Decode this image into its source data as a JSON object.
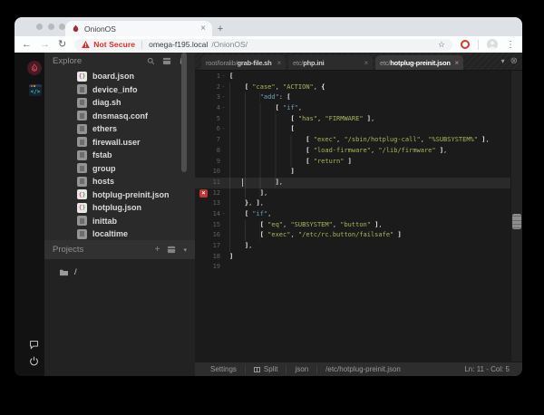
{
  "browser": {
    "tab_title": "OnionOS",
    "tab_close": "×",
    "new_tab": "+",
    "back": "←",
    "forward": "→",
    "reload": "↻",
    "security_text": "Not Secure",
    "url_host": "omega-f195.local",
    "url_path": "/OnionOS/",
    "bookmark_star": "☆",
    "menu_dots": "⋮"
  },
  "sidebar": {
    "explore_title": "Explore",
    "files": [
      {
        "name": "board.json",
        "type": "json"
      },
      {
        "name": "device_info",
        "type": "plain"
      },
      {
        "name": "diag.sh",
        "type": "plain"
      },
      {
        "name": "dnsmasq.conf",
        "type": "plain"
      },
      {
        "name": "ethers",
        "type": "plain"
      },
      {
        "name": "firewall.user",
        "type": "plain"
      },
      {
        "name": "fstab",
        "type": "plain"
      },
      {
        "name": "group",
        "type": "plain"
      },
      {
        "name": "hosts",
        "type": "plain"
      },
      {
        "name": "hotplug-preinit.json",
        "type": "json"
      },
      {
        "name": "hotplug.json",
        "type": "json"
      },
      {
        "name": "inittab",
        "type": "plain"
      },
      {
        "name": "localtime",
        "type": "plain"
      }
    ],
    "projects_title": "Projects",
    "project_items": [
      "/"
    ]
  },
  "editor": {
    "tabs": [
      {
        "path": "root/loralib/",
        "name": "grab-file.sh",
        "active": false
      },
      {
        "path": "etc/",
        "name": "php.ini",
        "active": false
      },
      {
        "path": "etc/",
        "name": "hotplug-preinit.json",
        "active": true
      }
    ],
    "tabbar_chevron": "▾",
    "tabbar_close_all": "⊗",
    "current_line": 11,
    "error_line": 12,
    "cursor_col": 5,
    "fold_lines": [
      1,
      2,
      3,
      4,
      6,
      14
    ],
    "lines": [
      [
        [
          "b",
          "["
        ]
      ],
      [
        [
          "p",
          "    "
        ],
        [
          "b",
          "["
        ],
        [
          "p",
          " "
        ],
        [
          "s",
          "\"case\""
        ],
        [
          "u",
          ","
        ],
        [
          "p",
          " "
        ],
        [
          "s",
          "\"ACTION\""
        ],
        [
          "u",
          ","
        ],
        [
          "p",
          " "
        ],
        [
          "b",
          "{"
        ]
      ],
      [
        [
          "p",
          "        "
        ],
        [
          "k",
          "\"add\""
        ],
        [
          "u",
          ":"
        ],
        [
          "p",
          " "
        ],
        [
          "b",
          "["
        ]
      ],
      [
        [
          "p",
          "            "
        ],
        [
          "b",
          "["
        ],
        [
          "p",
          " "
        ],
        [
          "k",
          "\"if\""
        ],
        [
          "u",
          ","
        ]
      ],
      [
        [
          "p",
          "                "
        ],
        [
          "b",
          "["
        ],
        [
          "p",
          " "
        ],
        [
          "s",
          "\"has\""
        ],
        [
          "u",
          ","
        ],
        [
          "p",
          " "
        ],
        [
          "s",
          "\"FIRMWARE\""
        ],
        [
          "p",
          " "
        ],
        [
          "b",
          "]"
        ],
        [
          "u",
          ","
        ]
      ],
      [
        [
          "p",
          "                "
        ],
        [
          "b",
          "["
        ]
      ],
      [
        [
          "p",
          "                    "
        ],
        [
          "b",
          "["
        ],
        [
          "p",
          " "
        ],
        [
          "s",
          "\"exec\""
        ],
        [
          "u",
          ","
        ],
        [
          "p",
          " "
        ],
        [
          "s",
          "\"/sbin/hotplug-call\""
        ],
        [
          "u",
          ","
        ],
        [
          "p",
          " "
        ],
        [
          "s",
          "\"%SUBSYSTEM%\""
        ],
        [
          "p",
          " "
        ],
        [
          "b",
          "]"
        ],
        [
          "u",
          ","
        ]
      ],
      [
        [
          "p",
          "                    "
        ],
        [
          "b",
          "["
        ],
        [
          "p",
          " "
        ],
        [
          "s",
          "\"load-firmware\""
        ],
        [
          "u",
          ","
        ],
        [
          "p",
          " "
        ],
        [
          "s",
          "\"/lib/firmware\""
        ],
        [
          "p",
          " "
        ],
        [
          "b",
          "]"
        ],
        [
          "u",
          ","
        ]
      ],
      [
        [
          "p",
          "                    "
        ],
        [
          "b",
          "["
        ],
        [
          "p",
          " "
        ],
        [
          "s",
          "\"return\""
        ],
        [
          "p",
          " "
        ],
        [
          "b",
          "]"
        ]
      ],
      [
        [
          "p",
          "                "
        ],
        [
          "b",
          "]"
        ]
      ],
      [
        [
          "p",
          "            "
        ],
        [
          "b",
          "]"
        ],
        [
          "u",
          ","
        ]
      ],
      [
        [
          "p",
          "        "
        ],
        [
          "b",
          "]"
        ],
        [
          "u",
          ","
        ]
      ],
      [
        [
          "p",
          "    "
        ],
        [
          "b",
          "}"
        ],
        [
          "u",
          ","
        ],
        [
          "p",
          " "
        ],
        [
          "b",
          "]"
        ],
        [
          "u",
          ","
        ]
      ],
      [
        [
          "p",
          "    "
        ],
        [
          "b",
          "["
        ],
        [
          "p",
          " "
        ],
        [
          "k",
          "\"if\""
        ],
        [
          "u",
          ","
        ]
      ],
      [
        [
          "p",
          "        "
        ],
        [
          "b",
          "["
        ],
        [
          "p",
          " "
        ],
        [
          "s",
          "\"eq\""
        ],
        [
          "u",
          ","
        ],
        [
          "p",
          " "
        ],
        [
          "s",
          "\"SUBSYSTEM\""
        ],
        [
          "u",
          ","
        ],
        [
          "p",
          " "
        ],
        [
          "s",
          "\"button\""
        ],
        [
          "p",
          " "
        ],
        [
          "b",
          "]"
        ],
        [
          "u",
          ","
        ]
      ],
      [
        [
          "p",
          "        "
        ],
        [
          "b",
          "["
        ],
        [
          "p",
          " "
        ],
        [
          "s",
          "\"exec\""
        ],
        [
          "u",
          ","
        ],
        [
          "p",
          " "
        ],
        [
          "s",
          "\"/etc/rc.button/failsafe\""
        ],
        [
          "p",
          " "
        ],
        [
          "b",
          "]"
        ]
      ],
      [
        [
          "p",
          "    "
        ],
        [
          "b",
          "]"
        ],
        [
          "u",
          ","
        ]
      ],
      [
        [
          "b",
          "]"
        ]
      ],
      []
    ]
  },
  "status_bar": {
    "settings_label": "Settings",
    "split_label": "Split",
    "mode_label": "json",
    "file_path": "/etc/hotplug-preinit.json",
    "cursor_position": "Ln: 11 - Col: 5"
  },
  "colors": {
    "string": "#a8b65c",
    "key": "#6f9fbf",
    "bracket": "#f0f0f0",
    "error": "#c13434",
    "not_secure": "#d93025",
    "active_tab_bg": "#3a3a3a",
    "onion_red": "#e0465a"
  },
  "icons": {
    "activity_bar": [
      "onion-logo-icon",
      "code-editor-icon",
      "chat-bubble-icon",
      "power-icon"
    ],
    "explore_header": [
      "search-icon",
      "package-icon",
      "lock-icon"
    ],
    "projects_header": [
      "plus-icon",
      "package-icon",
      "chevron-down-icon"
    ],
    "tab_bar": [
      "chevron-down-icon",
      "close-all-icon"
    ],
    "toolbar": [
      "back-icon",
      "forward-icon",
      "reload-icon",
      "warning-icon",
      "star-icon",
      "extension-o-icon",
      "profile-icon",
      "menu-dots-icon"
    ],
    "status_bar": [
      "split-icon"
    ]
  }
}
